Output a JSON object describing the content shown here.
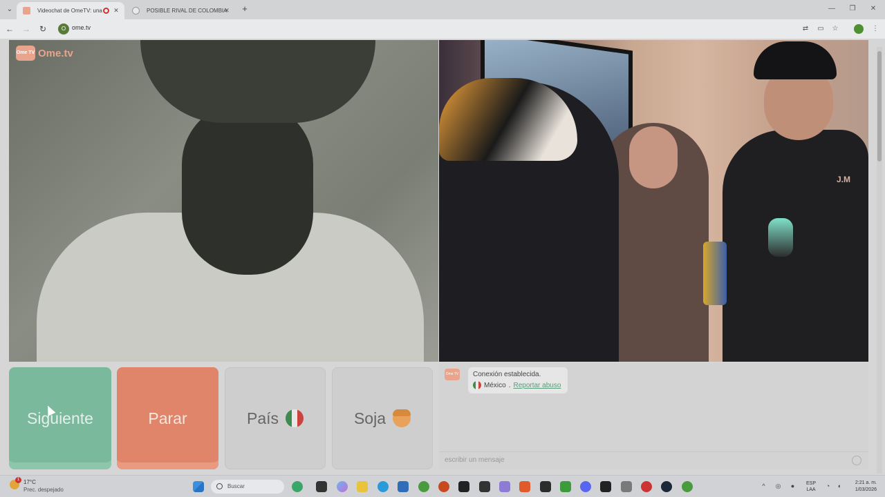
{
  "browser": {
    "tabs": [
      {
        "title": "Videochat de OmeTV: una",
        "active": true
      },
      {
        "title": "POSIBLE RIVAL DE COLOMBIA",
        "active": false
      }
    ],
    "url": "ome.tv",
    "site_icon_label": "O"
  },
  "page": {
    "logo_text": "Ome.tv",
    "logo_badge": "Ome TV",
    "buttons": {
      "next": "Siguiente",
      "stop": "Parar",
      "country": "País",
      "gender": "Soja"
    },
    "chat": {
      "status": "Conexión establecida.",
      "country": "México",
      "separator": " . ",
      "report": "Reportar abuso",
      "placeholder": "escribir un mensaje"
    },
    "video_right_text": "J.M"
  },
  "taskbar": {
    "weather_temp": "17°C",
    "weather_desc": "Prec. despejado",
    "weather_badge": "1",
    "search_label": "Buscar",
    "lang_top": "ESP",
    "lang_bottom": "LAA",
    "time": "2:21 a. m.",
    "date": "1/03/2026"
  },
  "colors": {
    "next_button": "#7bb99d",
    "stop_button": "#e08569",
    "brand": "#e8a48c"
  }
}
